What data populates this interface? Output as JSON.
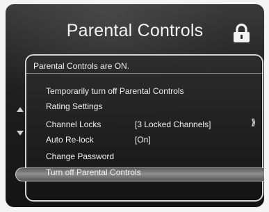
{
  "header": {
    "title": "Parental Controls",
    "lock_icon": "lock-icon"
  },
  "status": {
    "text": "Parental Controls are ON."
  },
  "menu": [
    {
      "label": "Temporarily turn off Parental Controls"
    },
    {
      "label": "Rating Settings"
    },
    {
      "label": "Channel Locks",
      "value": "[3 Locked Channels]",
      "selected": true
    },
    {
      "label": "Auto Re-lock",
      "value": "[On]"
    },
    {
      "label": "Change Password"
    },
    {
      "label": "Turn off Parental Controls"
    }
  ],
  "nav": {
    "up_icon": "arrow-up-icon",
    "down_icon": "arrow-down-icon",
    "right_icon": "chevron-right-icon",
    "right_symbol": "⟫"
  }
}
